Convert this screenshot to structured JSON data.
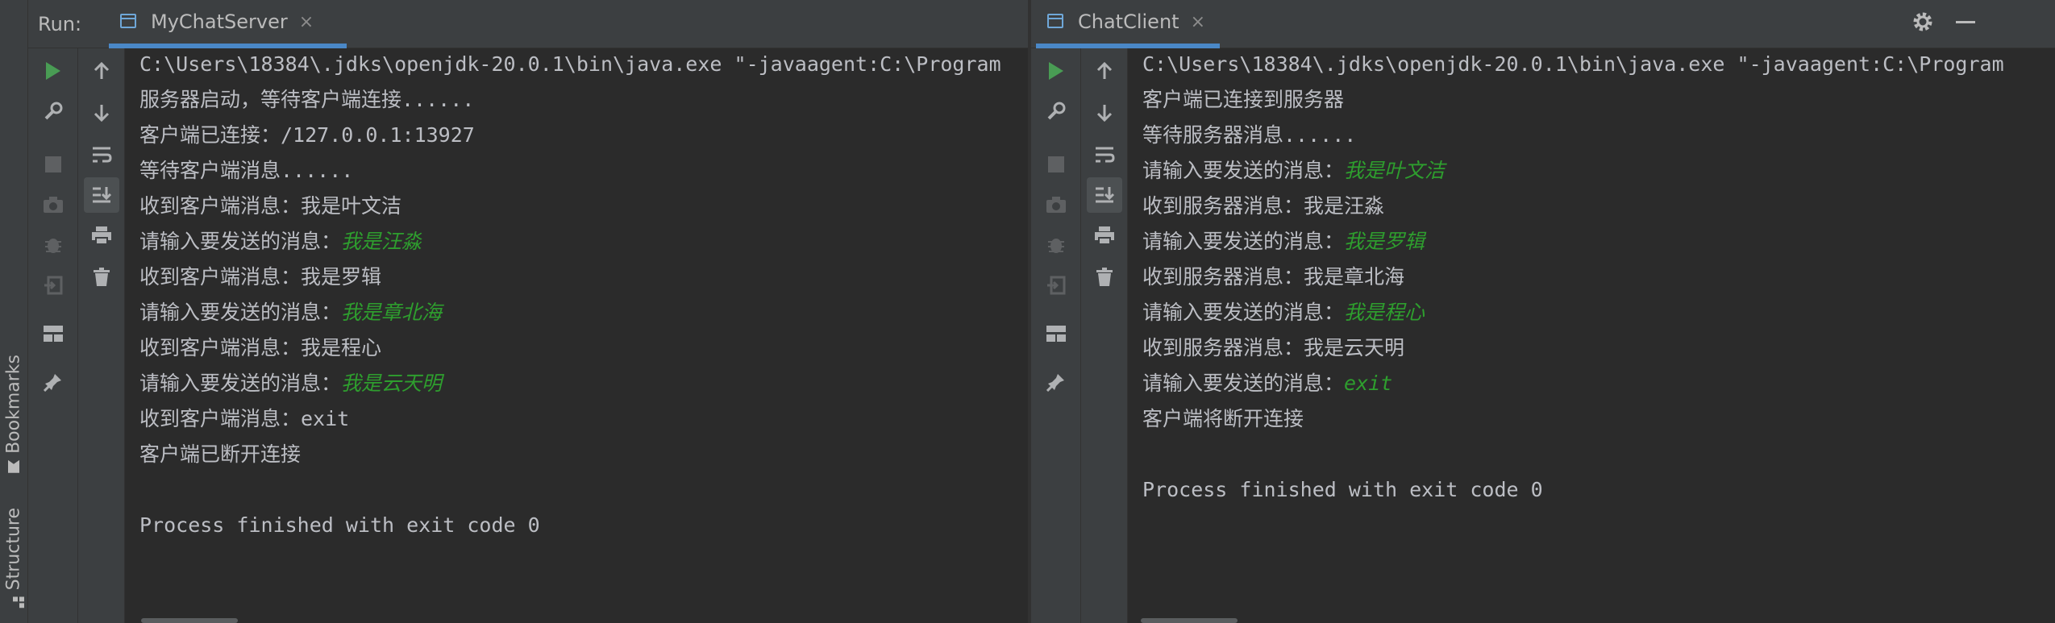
{
  "run_label": "Run:",
  "side_tabs": {
    "bookmarks": "Bookmarks",
    "structure": "Structure"
  },
  "server": {
    "tab_title": "MyChatServer",
    "close_glyph": "×",
    "lines": [
      {
        "prefix": "C:\\Users\\18384\\.jdks\\openjdk-20.0.1\\bin\\java.exe \"-javaagent:C:\\Program",
        "input": ""
      },
      {
        "prefix": "服务器启动，等待客户端连接......",
        "input": ""
      },
      {
        "prefix": "客户端已连接：/127.0.0.1:13927",
        "input": ""
      },
      {
        "prefix": "等待客户端消息......",
        "input": ""
      },
      {
        "prefix": "收到客户端消息：我是叶文洁",
        "input": ""
      },
      {
        "prefix": "请输入要发送的消息：",
        "input": "我是汪淼"
      },
      {
        "prefix": "收到客户端消息：我是罗辑",
        "input": ""
      },
      {
        "prefix": "请输入要发送的消息：",
        "input": "我是章北海"
      },
      {
        "prefix": "收到客户端消息：我是程心",
        "input": ""
      },
      {
        "prefix": "请输入要发送的消息：",
        "input": "我是云天明"
      },
      {
        "prefix": "收到客户端消息：exit",
        "input": ""
      },
      {
        "prefix": "客户端已断开连接",
        "input": ""
      },
      {
        "prefix": "",
        "input": ""
      },
      {
        "prefix": "Process finished with exit code 0",
        "input": ""
      }
    ]
  },
  "client": {
    "tab_title": "ChatClient",
    "close_glyph": "×",
    "lines": [
      {
        "prefix": "C:\\Users\\18384\\.jdks\\openjdk-20.0.1\\bin\\java.exe \"-javaagent:C:\\Program",
        "input": ""
      },
      {
        "prefix": "客户端已连接到服务器",
        "input": ""
      },
      {
        "prefix": "等待服务器消息......",
        "input": ""
      },
      {
        "prefix": "请输入要发送的消息：",
        "input": "我是叶文洁"
      },
      {
        "prefix": "收到服务器消息：我是汪淼",
        "input": ""
      },
      {
        "prefix": "请输入要发送的消息：",
        "input": "我是罗辑"
      },
      {
        "prefix": "收到服务器消息：我是章北海",
        "input": ""
      },
      {
        "prefix": "请输入要发送的消息：",
        "input": "我是程心"
      },
      {
        "prefix": "收到服务器消息：我是云天明",
        "input": ""
      },
      {
        "prefix": "请输入要发送的消息：",
        "input": "exit"
      },
      {
        "prefix": "客户端将断开连接",
        "input": ""
      },
      {
        "prefix": "",
        "input": ""
      },
      {
        "prefix": "Process finished with exit code 0",
        "input": ""
      }
    ]
  },
  "toolbar_icons": [
    "rerun-icon",
    "settings-wrench-icon",
    "stop-icon",
    "camera-icon",
    "debug-bug-icon",
    "exit-icon",
    "layout-icon",
    "pin-icon"
  ],
  "console_icons": [
    "up-arrow-icon",
    "down-arrow-icon",
    "soft-wrap-icon",
    "scroll-to-end-icon",
    "print-icon",
    "trash-icon"
  ],
  "colors": {
    "user_input": "#2e9e2e",
    "console_bg": "#2b2b2b",
    "toolbar_bg": "#3c3f41",
    "active_tab_underline": "#4a88c7"
  }
}
